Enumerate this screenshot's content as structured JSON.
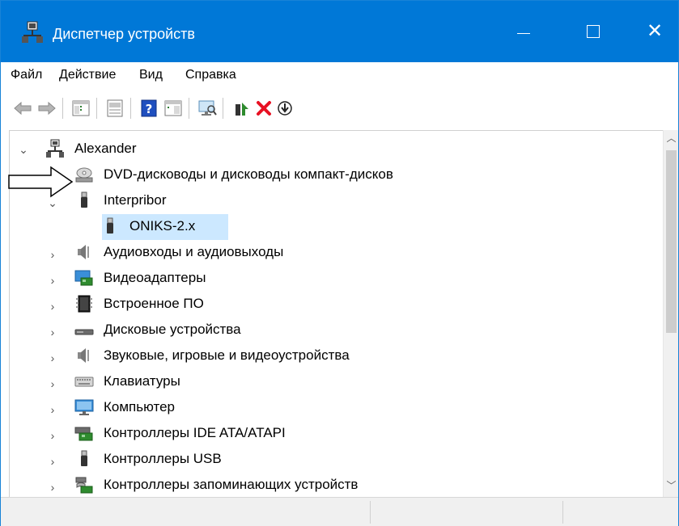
{
  "window": {
    "title": "Диспетчер устройств",
    "accent_color": "#0078d7"
  },
  "menu": [
    {
      "label": "Файл"
    },
    {
      "label": "Действие"
    },
    {
      "label": "Вид"
    },
    {
      "label": "Справка"
    }
  ],
  "toolbar": {
    "icons": [
      "back-arrow-icon",
      "forward-arrow-icon",
      "show-hide-tree-icon",
      "properties-icon",
      "help-icon",
      "action-pane-icon",
      "scan-hardware-icon",
      "update-driver-icon",
      "uninstall-device-icon",
      "disable-device-icon"
    ]
  },
  "tree": {
    "root": {
      "label": "Alexander",
      "icon": "computer-network-icon",
      "expanded": true
    },
    "items": [
      {
        "label": "DVD-дисководы и дисководы компакт-дисков",
        "icon": "dvd-drive-icon",
        "expanded": false,
        "level": 1,
        "chevron": "none"
      },
      {
        "label": "Interpribor",
        "icon": "usb-plug-icon",
        "expanded": true,
        "level": 1,
        "chevron": "down"
      },
      {
        "label": "ONIKS-2.x",
        "icon": "usb-plug-icon",
        "level": 2,
        "selected": true,
        "chevron": "none"
      },
      {
        "label": "Аудиовходы и аудиовыходы",
        "icon": "speaker-icon",
        "level": 1,
        "chevron": "right"
      },
      {
        "label": "Видеоадаптеры",
        "icon": "display-adapter-icon",
        "level": 1,
        "chevron": "right"
      },
      {
        "label": "Встроенное ПО",
        "icon": "firmware-chip-icon",
        "level": 1,
        "chevron": "right"
      },
      {
        "label": "Дисковые устройства",
        "icon": "disk-drive-icon",
        "level": 1,
        "chevron": "right"
      },
      {
        "label": "Звуковые, игровые и видеоустройства",
        "icon": "speaker-icon",
        "level": 1,
        "chevron": "right"
      },
      {
        "label": "Клавиатуры",
        "icon": "keyboard-icon",
        "level": 1,
        "chevron": "right"
      },
      {
        "label": "Компьютер",
        "icon": "monitor-icon",
        "level": 1,
        "chevron": "right"
      },
      {
        "label": "Контроллеры IDE ATA/ATAPI",
        "icon": "ide-controller-icon",
        "level": 1,
        "chevron": "right"
      },
      {
        "label": "Контроллеры USB",
        "icon": "usb-plug-icon",
        "level": 1,
        "chevron": "right"
      },
      {
        "label": "Контроллеры запоминающих устройств",
        "icon": "storage-controller-icon",
        "level": 1,
        "chevron": "right"
      }
    ]
  },
  "selection_color": "#cce8ff"
}
